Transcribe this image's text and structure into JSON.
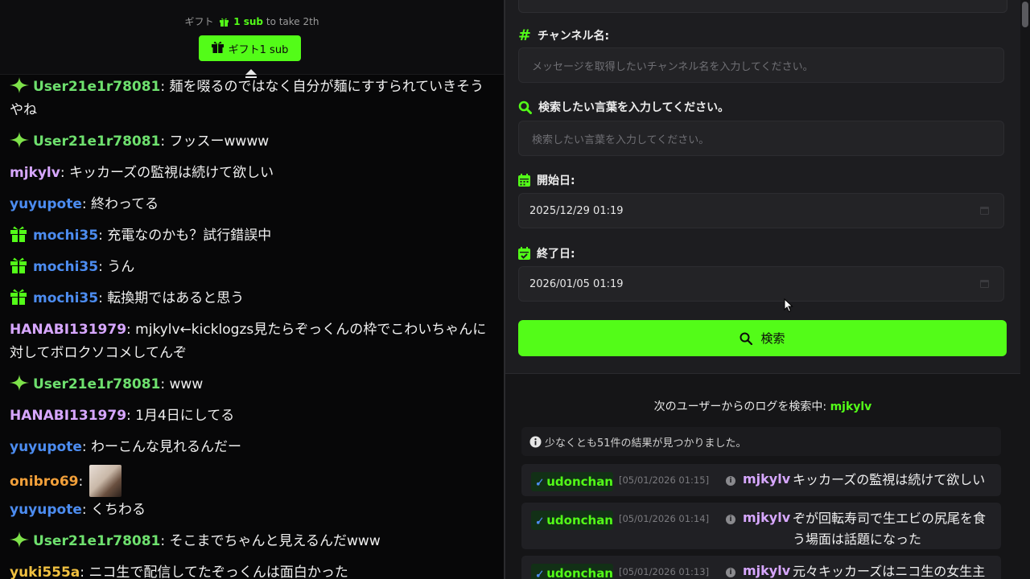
{
  "gift": {
    "prefix": "ギフト",
    "sub": "1 sub",
    "suffix": "to take 2th",
    "button_label": "ギフト1 sub"
  },
  "chat": [
    {
      "icon": "sparkle-badge-icon",
      "user": "User21e1r78081",
      "color": "u-green",
      "text": ": 麺を啜るのではなく自分が麺にすすられていきそうやね"
    },
    {
      "icon": "sparkle-badge-icon",
      "user": "User21e1r78081",
      "color": "u-green",
      "text": ": フッスーwwww"
    },
    {
      "icon": "",
      "user": "mjkylv",
      "color": "u-purple",
      "text": ": キッカーズの監視は続けて欲しい"
    },
    {
      "icon": "",
      "user": "yuyupote",
      "color": "u-blue",
      "text": ": 終わってる"
    },
    {
      "icon": "gift-badge-icon",
      "user": "mochi35",
      "color": "u-blue",
      "text": ": 充電なのかも？試行錯誤中"
    },
    {
      "icon": "gift-badge-icon",
      "user": "mochi35",
      "color": "u-blue",
      "text": ": うん"
    },
    {
      "icon": "gift-badge-icon",
      "user": "mochi35",
      "color": "u-blue",
      "text": ": 転換期ではあると思う"
    },
    {
      "icon": "",
      "user": "HANABI131979",
      "color": "u-purple",
      "text": ": mjkylv←kicklogzs見たらぞっくんの枠でこわいちゃんに対してボロクソコメしてんぞ"
    },
    {
      "icon": "sparkle-badge-icon",
      "user": "User21e1r78081",
      "color": "u-green",
      "text": ": www"
    },
    {
      "icon": "",
      "user": "HANABI131979",
      "color": "u-purple",
      "text": ": 1月4日にしてる"
    },
    {
      "icon": "",
      "user": "yuyupote",
      "color": "u-blue",
      "text": ": わーこんな見れるんだー"
    },
    {
      "icon": "",
      "user": "onibro69",
      "color": "u-orange",
      "text": ": "
    },
    {
      "icon": "",
      "user": "yuyupote",
      "color": "u-blue",
      "text": ": くちわる"
    },
    {
      "icon": "sparkle-badge-icon",
      "user": "User21e1r78081",
      "color": "u-green",
      "text": ": そこまでちゃんと見えるんだwww"
    },
    {
      "icon": "",
      "user": "yuki555a",
      "color": "u-gold",
      "text": ": ニコ生で配信してたぞっくんは面白かった"
    }
  ],
  "form": {
    "channel_label": "チャンネル名:",
    "channel_placeholder": "メッセージを取得したいチャンネル名を入力してください。",
    "keyword_label": "検索したい言葉を入力してください。",
    "keyword_placeholder": "検索したい言葉を入力してください。",
    "start_label": "開始日:",
    "start_value": "2025/12/29 01:19",
    "end_label": "終了日:",
    "end_value": "2026/01/05 01:19",
    "search_button": "検索"
  },
  "results": {
    "heading_prefix": "次のユーザーからのログを検索中:",
    "heading_user": "mjkylv",
    "count_text": "少なくとも51件の結果が見つかりました。",
    "rows": [
      {
        "channel": "udonchan",
        "time": "[05/01/2026 01:15]",
        "user": "mjkylv",
        "message": "キッカーズの監視は続けて欲しい"
      },
      {
        "channel": "udonchan",
        "time": "[05/01/2026 01:14]",
        "user": "mjkylv",
        "message": "ぞが回転寿司で生エビの尻尾を食う場面は話題になった"
      },
      {
        "channel": "udonchan",
        "time": "[05/01/2026 01:13]",
        "user": "mjkylv",
        "message": "元々キッカーズはニコ生の女生主へ"
      }
    ]
  },
  "colors": {
    "accent": "#53fc18",
    "panel": "#1d1d20",
    "chat_bg": "#070708"
  }
}
